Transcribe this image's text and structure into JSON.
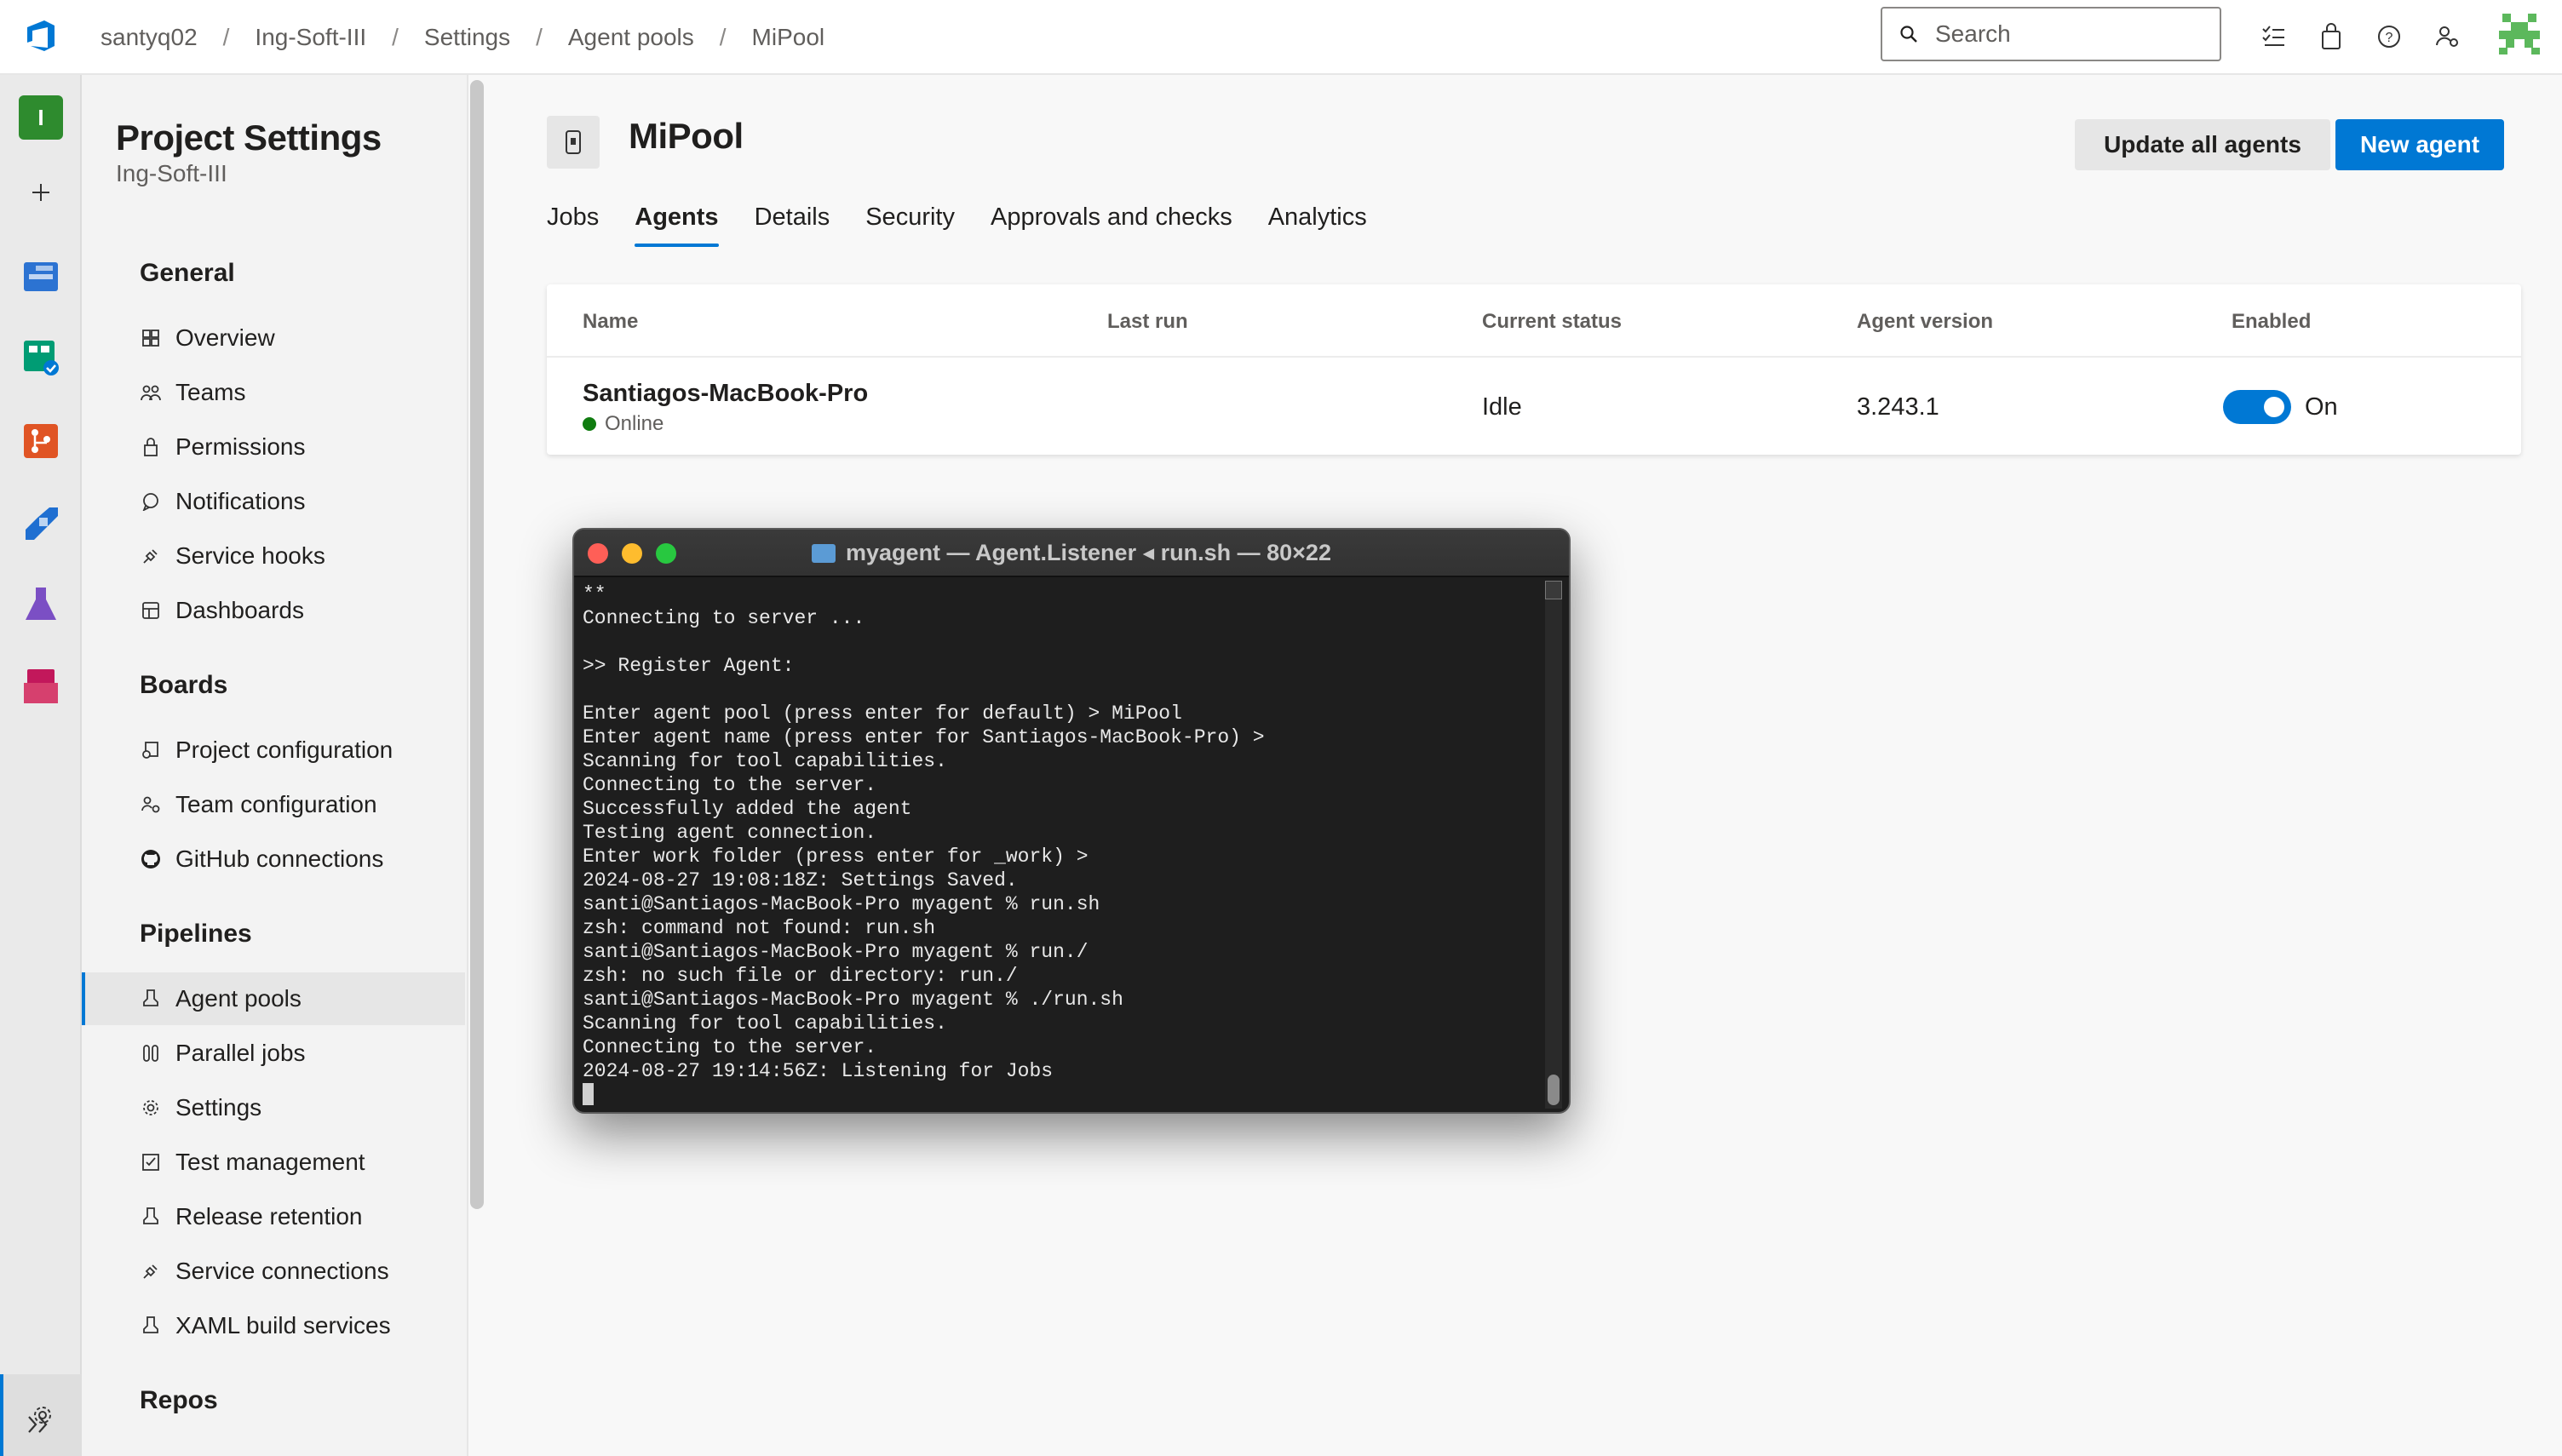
{
  "breadcrumb": [
    "santyq02",
    "Ing-Soft-III",
    "Settings",
    "Agent pools",
    "MiPool"
  ],
  "search": {
    "placeholder": "Search"
  },
  "project": {
    "title": "Project Settings",
    "subtitle": "Ing-Soft-III"
  },
  "rail": {
    "project_initial": "I"
  },
  "nav": {
    "general": {
      "heading": "General",
      "items": [
        "Overview",
        "Teams",
        "Permissions",
        "Notifications",
        "Service hooks",
        "Dashboards"
      ]
    },
    "boards": {
      "heading": "Boards",
      "items": [
        "Project configuration",
        "Team configuration",
        "GitHub connections"
      ]
    },
    "pipelines": {
      "heading": "Pipelines",
      "items": [
        "Agent pools",
        "Parallel jobs",
        "Settings",
        "Test management",
        "Release retention",
        "Service connections",
        "XAML build services"
      ]
    },
    "repos": {
      "heading": "Repos"
    }
  },
  "pool": {
    "title": "MiPool",
    "update_label": "Update all agents",
    "new_label": "New agent"
  },
  "tabs": [
    "Jobs",
    "Agents",
    "Details",
    "Security",
    "Approvals and checks",
    "Analytics"
  ],
  "active_tab": "Agents",
  "table": {
    "headers": [
      "Name",
      "Last run",
      "Current status",
      "Agent version",
      "Enabled"
    ],
    "rows": [
      {
        "name": "Santiagos-MacBook-Pro",
        "online": "Online",
        "last_run": "",
        "status": "Idle",
        "version": "3.243.1",
        "enabled": "On"
      }
    ]
  },
  "terminal": {
    "title": "myagent — Agent.Listener ◂ run.sh — 80×22",
    "lines": [
      "**",
      "Connecting to server ...",
      "",
      ">> Register Agent:",
      "",
      "Enter agent pool (press enter for default) > MiPool",
      "Enter agent name (press enter for Santiagos-MacBook-Pro) >",
      "Scanning for tool capabilities.",
      "Connecting to the server.",
      "Successfully added the agent",
      "Testing agent connection.",
      "Enter work folder (press enter for _work) >",
      "2024-08-27 19:08:18Z: Settings Saved.",
      "santi@Santiagos-MacBook-Pro myagent % run.sh",
      "zsh: command not found: run.sh",
      "santi@Santiagos-MacBook-Pro myagent % run./",
      "zsh: no such file or directory: run./",
      "santi@Santiagos-MacBook-Pro myagent % ./run.sh",
      "Scanning for tool capabilities.",
      "Connecting to the server.",
      "2024-08-27 19:14:56Z: Listening for Jobs"
    ]
  },
  "colors": {
    "accent": "#0078d4",
    "online": "#107c10",
    "terminal_bg": "#1e1e1e"
  }
}
